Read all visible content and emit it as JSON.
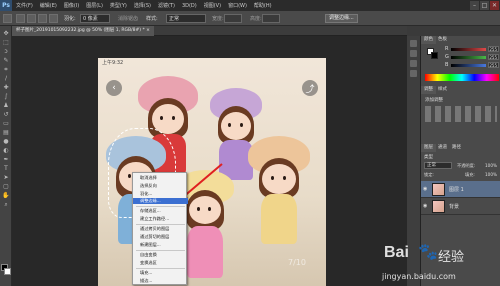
{
  "app": {
    "logo": "Ps"
  },
  "menubar": {
    "items": [
      "文件(F)",
      "编辑(E)",
      "图像(I)",
      "图层(L)",
      "类型(Y)",
      "选择(S)",
      "滤镜(T)",
      "3D(D)",
      "视图(V)",
      "窗口(W)",
      "帮助(H)"
    ]
  },
  "window_controls": {
    "minimize": "–",
    "maximize": "□",
    "close": "✕"
  },
  "options_bar": {
    "feather_label": "羽化:",
    "feather_value": "0 像素",
    "antialias_label": "消除锯齿",
    "style_label": "样式:",
    "style_value": "正常",
    "width_label": "宽度:",
    "height_label": "高度:",
    "refine_button": "调整边缘..."
  },
  "document": {
    "tab_title": "杯子图片_20191015092232.jpg @ 50% (图层 1, RGB/8#) *",
    "tab_close": "×"
  },
  "photo": {
    "status_time": "上午9:32",
    "back_icon": "‹",
    "share_icon": "⤴",
    "watermark": "7/10"
  },
  "context_menu": {
    "items": [
      {
        "label": "取消选择",
        "highlight": false
      },
      {
        "label": "选择反向",
        "highlight": false
      },
      {
        "label": "羽化...",
        "highlight": false
      },
      {
        "label": "调整边缘...",
        "highlight": true
      },
      {
        "label": "存储选区...",
        "highlight": false
      },
      {
        "label": "建立工作路径...",
        "highlight": false
      },
      {
        "label": "通过拷贝的图层",
        "highlight": false
      },
      {
        "label": "通过剪切的图层",
        "highlight": false
      },
      {
        "label": "新建图层...",
        "highlight": false
      },
      {
        "label": "自由变换",
        "highlight": false
      },
      {
        "label": "变换选区",
        "highlight": false
      },
      {
        "label": "填充...",
        "highlight": false
      },
      {
        "label": "描边...",
        "highlight": false
      }
    ]
  },
  "color_panel": {
    "tabs": [
      "颜色",
      "色板"
    ],
    "sliders": [
      {
        "label": "R",
        "value": "255",
        "color": "#e04848"
      },
      {
        "label": "G",
        "value": "255",
        "color": "#48b848"
      },
      {
        "label": "B",
        "value": "255",
        "color": "#4878e0"
      }
    ]
  },
  "adjust_panel": {
    "tabs": [
      "调整",
      "样式"
    ],
    "add_label": "添加调整"
  },
  "layers_panel": {
    "tabs": [
      "图层",
      "通道",
      "路径"
    ],
    "kind_label": "类型",
    "blend_mode": "正常",
    "opacity_label": "不透明度:",
    "opacity_value": "100%",
    "lock_label": "锁定:",
    "fill_label": "填充:",
    "fill_value": "100%",
    "layers": [
      {
        "name": "图层 1",
        "selected": true
      },
      {
        "name": "背景",
        "selected": false
      }
    ]
  },
  "watermark": {
    "brand": "Bai",
    "brand2": "经验",
    "url": "jingyan.baidu.com"
  },
  "colors": {
    "accent_highlight": "#3b6fd1",
    "ui_dark": "#3a3a3a"
  }
}
